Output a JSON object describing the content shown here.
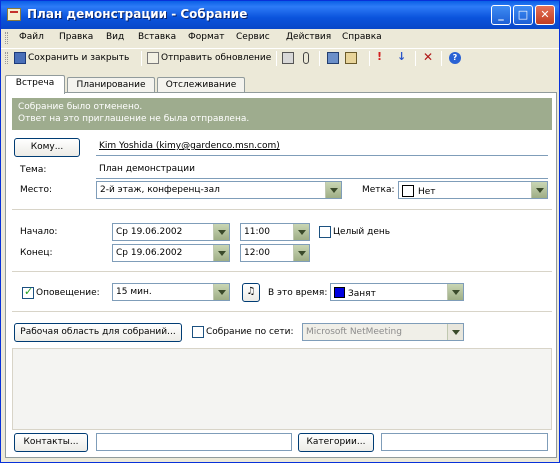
{
  "window": {
    "title": "План демонстрации - Собрание"
  },
  "menu": [
    "Файл",
    "Правка",
    "Вид",
    "Вставка",
    "Формат",
    "Сервис",
    "Действия",
    "Справка"
  ],
  "toolbar": {
    "save_close": "Сохранить и закрыть",
    "send_update": "Отправить обновление"
  },
  "tabs": [
    "Встреча",
    "Планирование",
    "Отслеживание"
  ],
  "info": {
    "line1": "Собрание было отменено.",
    "line2": "Ответ на это приглашение не была отправлена."
  },
  "form": {
    "to_button": "Кому...",
    "to_value": "Kim Yoshida (kimy@gardenco.msn.com)",
    "subject_label": "Тема:",
    "subject_value": "План демонстрации",
    "location_label": "Место:",
    "location_value": "2-й этаж, конференц-зал",
    "label_label": "Метка:",
    "label_value": "Нет",
    "start_label": "Начало:",
    "start_date": "Ср 19.06.2002",
    "start_time": "11:00",
    "allday_label": "Целый день",
    "end_label": "Конец:",
    "end_date": "Ср 19.06.2002",
    "end_time": "12:00",
    "reminder_label": "Оповещение:",
    "reminder_value": "15 мин.",
    "showtime_label": "В это время:",
    "showtime_value": "Занят",
    "showtime_color": "#0000e0",
    "workspace_button": "Рабочая область для собраний...",
    "online_label": "Собрание по сети:",
    "online_value": "Microsoft NetMeeting",
    "contacts_button": "Контакты...",
    "categories_button": "Категории..."
  }
}
